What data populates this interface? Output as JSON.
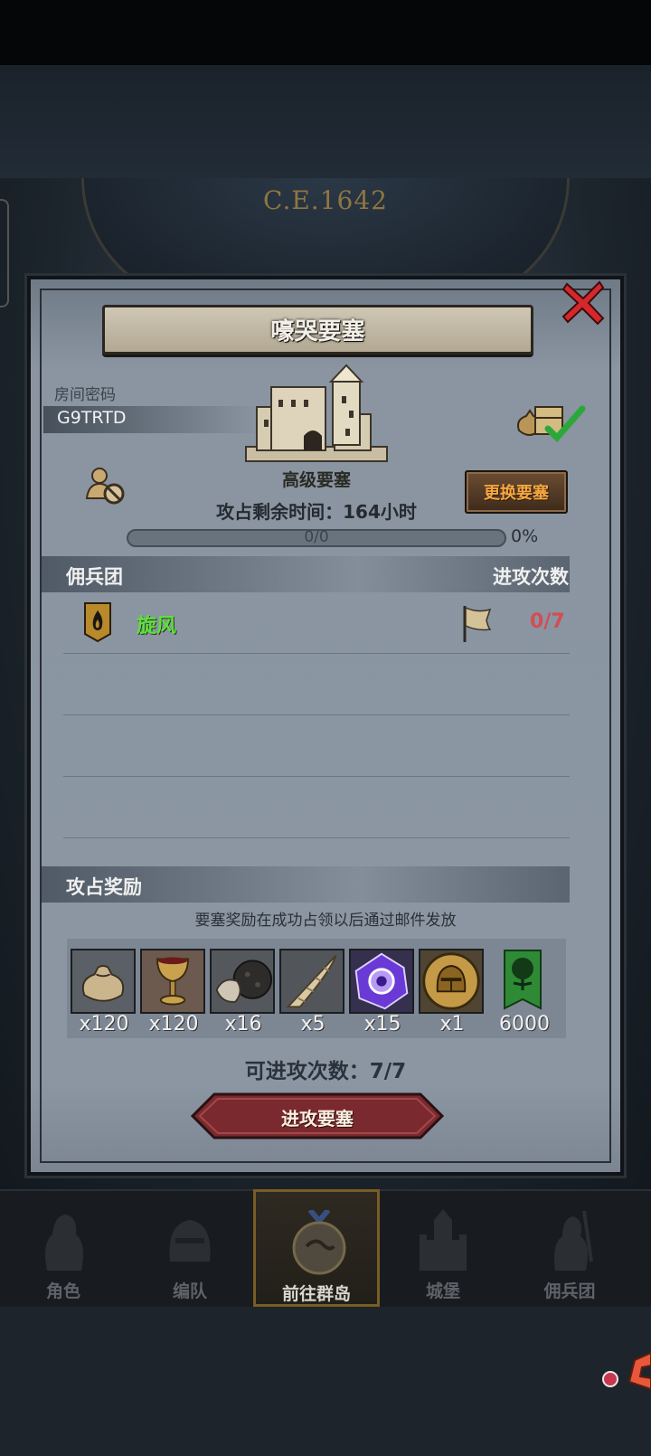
{
  "header": {
    "year": "C.E.1642"
  },
  "dialog": {
    "title": "嚎哭要塞",
    "room_label": "房间密码",
    "room_code": "G9TRTD",
    "fortress_type": "高级要塞",
    "time_remaining": "攻占剩余时间：164小时",
    "change_button": "更换要塞",
    "progress": {
      "text": "0/0",
      "percent_label": "0%",
      "fraction": 0.0
    },
    "mercenary_header": "佣兵团",
    "attacks_header": "进攻次数",
    "guilds": [
      {
        "name": "旋风",
        "attacks": "0/7"
      }
    ],
    "rewards_header": "攻占奖励",
    "rewards_note": "要塞奖励在成功占领以后通过邮件发放",
    "rewards": [
      {
        "icon": "pouch-icon",
        "qty": "x120"
      },
      {
        "icon": "goblet-icon",
        "qty": "x120"
      },
      {
        "icon": "ore-icon",
        "qty": "x16"
      },
      {
        "icon": "horn-icon",
        "qty": "x5"
      },
      {
        "icon": "purple-gem-icon",
        "qty": "x15"
      },
      {
        "icon": "helmet-coin-icon",
        "qty": "x1"
      },
      {
        "icon": "tree-banner-icon",
        "qty": "6000"
      }
    ],
    "remaining_attacks": "可进攻次数：7/7",
    "attack_button": "进攻要塞"
  },
  "nav": {
    "items": [
      {
        "label": "角色",
        "icon": "knight-icon"
      },
      {
        "label": "编队",
        "icon": "helmet-icon"
      },
      {
        "label": "前往群岛",
        "icon": "compass-map-icon"
      },
      {
        "label": "城堡",
        "icon": "castle-icon"
      },
      {
        "label": "佣兵团",
        "icon": "soldier-icon"
      }
    ]
  },
  "colors": {
    "accent_gold": "#c49a46",
    "guild_green": "#5ee03c",
    "count_red": "#d34d55",
    "button_orange": "#f7a740"
  }
}
